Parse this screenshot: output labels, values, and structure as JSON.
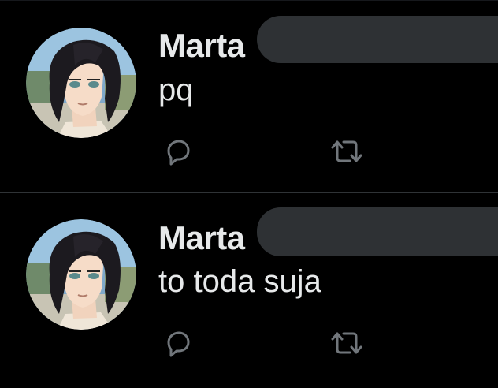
{
  "tweets": [
    {
      "author_name": "Marta",
      "text": "pq",
      "icons": {
        "reply": "reply-icon",
        "retweet": "retweet-icon",
        "avatar": "anime-character-avatar"
      }
    },
    {
      "author_name": "Marta",
      "text": "to toda suja",
      "icons": {
        "reply": "reply-icon",
        "retweet": "retweet-icon",
        "avatar": "anime-character-avatar"
      }
    }
  ],
  "colors": {
    "background": "#000000",
    "text": "#e7e9ea",
    "icon": "#71767b",
    "divider": "#2f3336",
    "redaction": "#2e3134"
  }
}
